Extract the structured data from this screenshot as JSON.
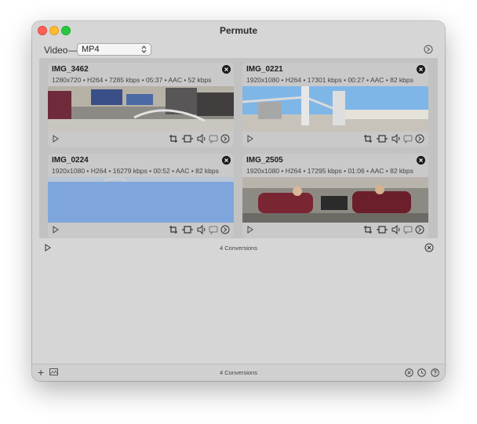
{
  "window": {
    "title": "Permute"
  },
  "toolbar": {
    "media_label": "Video",
    "dash": "—",
    "format_value": "MP4"
  },
  "cards": [
    {
      "name": "IMG_3462",
      "meta": "1280x720 • H264 • 7285 kbps • 05:37 • AAC • 52 kbps"
    },
    {
      "name": "IMG_0221",
      "meta": "1920x1080 • H264 • 17301 kbps • 00:27 • AAC • 82 kbps"
    },
    {
      "name": "IMG_0224",
      "meta": "1920x1080 • H264 • 16279 kbps • 00:52 • AAC • 82 kbps"
    },
    {
      "name": "IMG_2505",
      "meta": "1920x1080 • H264 • 17295 kbps • 01:06 • AAC • 82 kbps"
    }
  ],
  "status": {
    "conversions": "4 Conversions"
  },
  "bottom": {
    "add": "+",
    "conversions": "4 Conversions"
  },
  "icons": [
    "close-icon",
    "play-icon",
    "crop-icon",
    "trim-icon",
    "volume-icon",
    "subtitles-icon",
    "settings-icon",
    "clear-icon",
    "history-icon",
    "help-icon",
    "add-icon",
    "preview-icon",
    "chevron-updown-icon"
  ],
  "colors": {
    "red": "#ff5f57",
    "yellow": "#febc2e",
    "green": "#28c840",
    "sky": "#7fb6e8"
  }
}
